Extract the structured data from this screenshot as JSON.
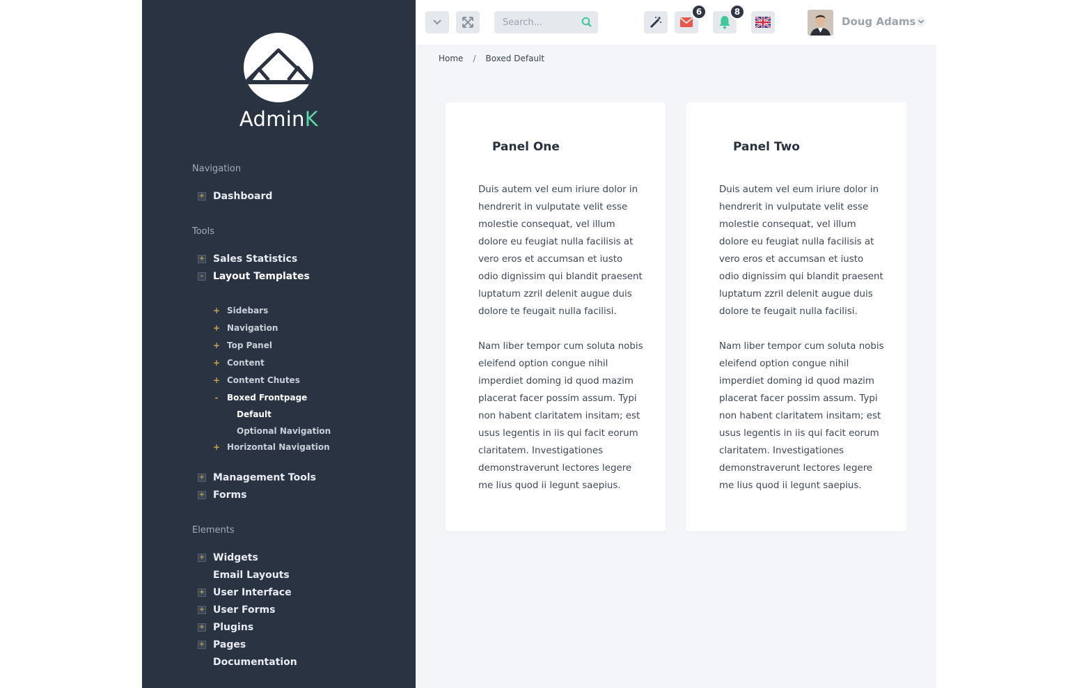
{
  "brand": {
    "name_main": "Admin",
    "name_accent": "K"
  },
  "sidebar": {
    "sections": [
      {
        "label": "Navigation"
      },
      {
        "label": "Tools"
      },
      {
        "label": "Elements"
      }
    ],
    "items": {
      "dashboard": {
        "label": "Dashboard",
        "toggle": "+"
      },
      "sales_statistics": {
        "label": "Sales Statistics",
        "toggle": "+"
      },
      "layout_templates": {
        "label": "Layout Templates",
        "toggle": "-"
      },
      "management_tools": {
        "label": "Management Tools",
        "toggle": "+"
      },
      "forms": {
        "label": "Forms",
        "toggle": "+"
      },
      "widgets": {
        "label": "Widgets",
        "toggle": "+"
      },
      "email_layouts": {
        "label": "Email Layouts"
      },
      "user_interface": {
        "label": "User Interface",
        "toggle": "+"
      },
      "user_forms": {
        "label": "User Forms",
        "toggle": "+"
      },
      "plugins": {
        "label": "Plugins",
        "toggle": "+"
      },
      "pages": {
        "label": "Pages",
        "toggle": "+"
      },
      "documentation": {
        "label": "Documentation"
      }
    },
    "layout_sub": {
      "sidebars": {
        "label": "Sidebars",
        "marker": "+"
      },
      "navigation": {
        "label": "Navigation",
        "marker": "+"
      },
      "top_panel": {
        "label": "Top Panel",
        "marker": "+"
      },
      "content": {
        "label": "Content",
        "marker": "+"
      },
      "content_chutes": {
        "label": "Content Chutes",
        "marker": "+"
      },
      "boxed_frontpage": {
        "label": "Boxed Frontpage",
        "marker": "-"
      },
      "horizontal_navigation": {
        "label": "Horizontal Navigation",
        "marker": "+"
      }
    },
    "boxed_sub": {
      "default": {
        "label": "Default"
      },
      "optional_navigation": {
        "label": "Optional Navigation"
      }
    }
  },
  "topbar": {
    "search_placeholder": "Search...",
    "mail_count": "6",
    "notification_count": "8",
    "user_name": "Doug Adams"
  },
  "breadcrumb": {
    "home": "Home",
    "separator": "/",
    "current": "Boxed Default"
  },
  "panels": [
    {
      "title": "Panel One",
      "p1": "Duis autem vel eum iriure dolor in hendrerit in vulputate velit esse molestie consequat, vel illum dolore eu feugiat nulla facilisis at vero eros et accumsan et iusto odio dignissim qui blandit praesent luptatum zzril delenit augue duis dolore te feugait nulla facilisi.",
      "p2": "Nam liber tempor cum soluta nobis eleifend option congue nihil imperdiet doming id quod mazim placerat facer possim assum. Typi non habent claritatem insitam; est usus legentis in iis qui facit eorum claritatem. Investigationes demonstraverunt lectores legere me lius quod ii legunt saepius."
    },
    {
      "title": "Panel Two",
      "p1": "Duis autem vel eum iriure dolor in hendrerit in vulputate velit esse molestie consequat, vel illum dolore eu feugiat nulla facilisis at vero eros et accumsan et iusto odio dignissim qui blandit praesent luptatum zzril delenit augue duis dolore te feugait nulla facilisi.",
      "p2": "Nam liber tempor cum soluta nobis eleifend option congue nihil imperdiet doming id quod mazim placerat facer possim assum. Typi non habent claritatem insitam; est usus legentis in iis qui facit eorum claritatem. Investigationes demonstraverunt lectores legere me lius quod ii legunt saepius."
    }
  ],
  "colors": {
    "sidebar_bg": "#2a3342",
    "accent": "#5cd6a6",
    "mail": "#e8574a",
    "bell": "#3fc89a",
    "toggle_marker": "#c5a34a"
  },
  "icons": [
    "mountain-logo-icon",
    "chevron-down-icon",
    "fullscreen-icon",
    "search-icon",
    "magic-wand-icon",
    "envelope-icon",
    "bell-icon",
    "uk-flag-icon"
  ]
}
